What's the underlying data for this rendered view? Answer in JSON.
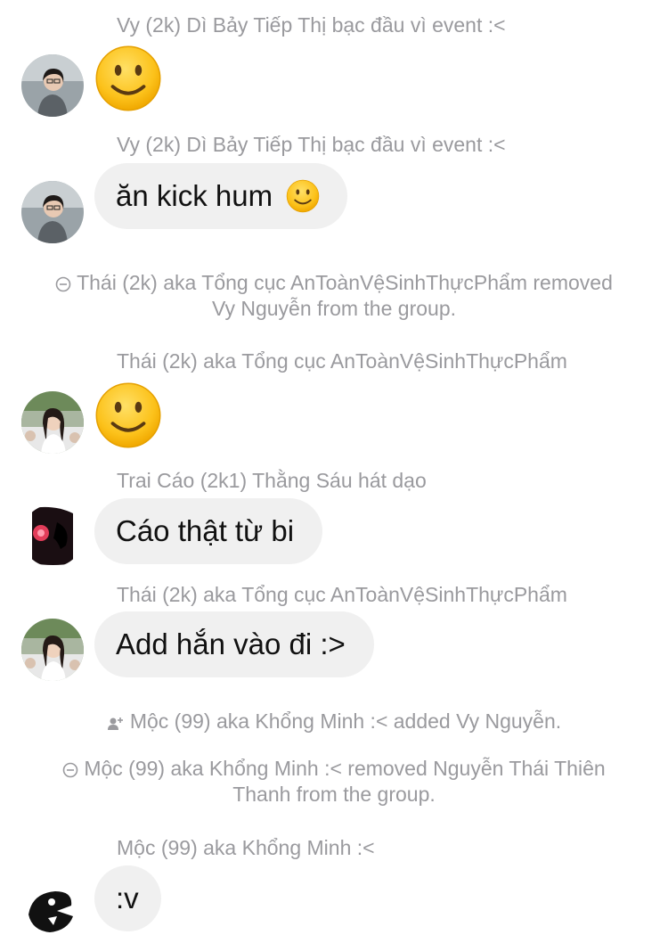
{
  "messages": {
    "m1": {
      "sender": "Vy (2k) Dì Bảy Tiếp Thị bạc đầu vì event :<"
    },
    "m2": {
      "sender": "Vy (2k) Dì Bảy Tiếp Thị bạc đầu vì event :<",
      "text": "ăn kick hum"
    },
    "sys1": {
      "line1": "Thái (2k) aka Tổng cục AnToànVệSinhThựcPhẩm removed",
      "line2": "Vy Nguyễn from the group."
    },
    "m3": {
      "sender": "Thái (2k) aka Tổng cục AnToànVệSinhThựcPhẩm"
    },
    "m4": {
      "sender": "Trai Cáo (2k1) Thằng Sáu hát dạo",
      "text": "Cáo thật từ bi"
    },
    "m5": {
      "sender": "Thái (2k) aka Tổng cục AnToànVệSinhThựcPhẩm",
      "text": "Add hắn vào đi :>"
    },
    "sys2": {
      "text": "Mộc (99) aka Khổng Minh :< added Vy Nguyễn."
    },
    "sys3": {
      "line1": "Mộc (99) aka Khổng Minh :< removed Nguyễn Thái Thiên",
      "line2": "Thanh from the group."
    },
    "m6": {
      "sender": "Mộc (99) aka Khổng Minh :<",
      "text": ":v"
    }
  },
  "icons": {
    "smile": "slightly-smiling-face-emoji",
    "removed": "remove-circle-icon",
    "added": "add-person-icon"
  },
  "colors": {
    "bubble": "#f0f0f0",
    "meta_text": "#9a9a9e",
    "emoji_yellow": "#fcc21b"
  }
}
